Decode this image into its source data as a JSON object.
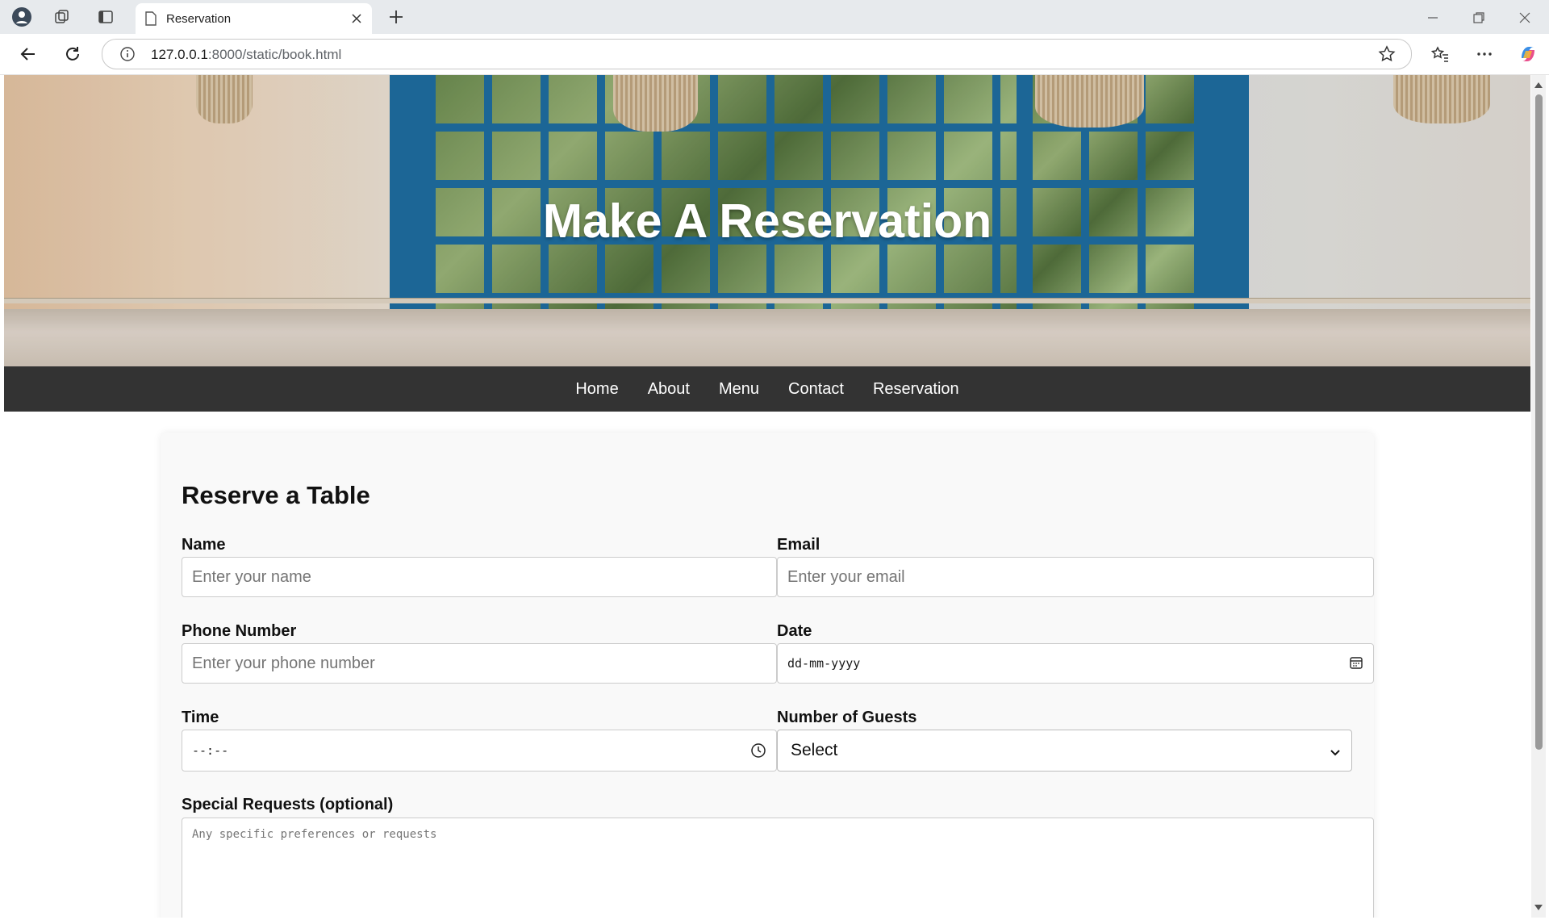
{
  "browser": {
    "tab_title": "Reservation",
    "url_host": "127.0.0.1",
    "url_path": ":8000/static/book.html"
  },
  "hero": {
    "title": "Make A Reservation"
  },
  "nav": {
    "items": [
      "Home",
      "About",
      "Menu",
      "Contact",
      "Reservation"
    ]
  },
  "form": {
    "title": "Reserve a Table",
    "name_label": "Name",
    "name_placeholder": "Enter your name",
    "email_label": "Email",
    "email_placeholder": "Enter your email",
    "phone_label": "Phone Number",
    "phone_placeholder": "Enter your phone number",
    "date_label": "Date",
    "date_value": "dd-mm-yyyy",
    "time_label": "Time",
    "time_value": "--:--",
    "guests_label": "Number of Guests",
    "guests_selected": "Select",
    "requests_label": "Special Requests (optional)",
    "requests_placeholder": "Any specific preferences or requests"
  },
  "colors": {
    "nav_background": "#333333",
    "card_background": "#f9f9f9",
    "window_blue": "#1f6fa3"
  }
}
